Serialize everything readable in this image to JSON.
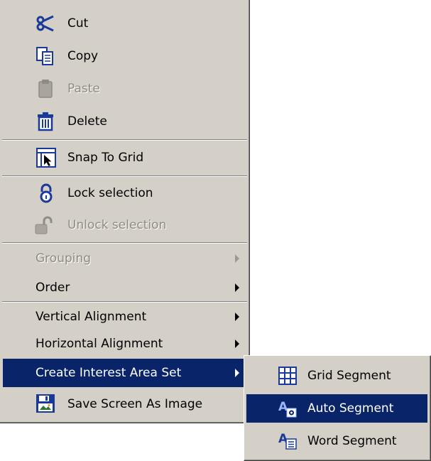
{
  "context_menu": {
    "items": {
      "cut": "Cut",
      "copy": "Copy",
      "paste": "Paste",
      "delete": "Delete",
      "snap_to_grid": "Snap To Grid",
      "lock_selection": "Lock selection",
      "unlock_selection": "Unlock selection",
      "grouping": "Grouping",
      "order": "Order",
      "vertical_alignment": "Vertical Alignment",
      "horizontal_alignment": "Horizontal Alignment",
      "create_interest_area_set": "Create Interest Area Set",
      "save_screen_as_image": "Save Screen As Image"
    },
    "disabled": [
      "Paste",
      "Unlock selection",
      "Grouping"
    ],
    "highlighted": "Create Interest Area Set"
  },
  "submenu": {
    "items": {
      "grid_segment": "Grid Segment",
      "auto_segment": "Auto Segment",
      "word_segment": "Word Segment"
    },
    "highlighted": "Auto Segment"
  },
  "colors": {
    "menu_background": "#d4d0c8",
    "highlight": "#0a246a",
    "disabled_text": "#8e8b83"
  },
  "icons": [
    "scissors-icon",
    "copy-icon",
    "paste-icon",
    "trash-icon",
    "snap-grid-icon",
    "lock-icon",
    "unlock-icon",
    "grid-segment-icon",
    "auto-segment-icon",
    "word-segment-icon",
    "save-image-icon"
  ]
}
